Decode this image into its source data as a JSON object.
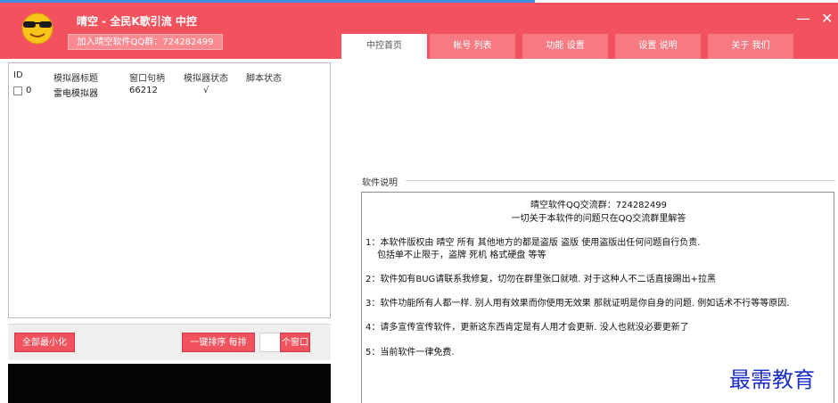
{
  "app": {
    "title": "晴空 - 全民K歌引流 中控",
    "qq_group_label": "加入晴空软件QQ群：724282499",
    "minimize_symbol": "—",
    "close_symbol": "✕"
  },
  "tabs": [
    {
      "label": "中控首页",
      "active": true
    },
    {
      "label": "帐号 列表",
      "active": false
    },
    {
      "label": "功能 设置",
      "active": false
    },
    {
      "label": "设置 说明",
      "active": false
    },
    {
      "label": "关于 我们",
      "active": false
    }
  ],
  "table": {
    "headers": [
      "ID",
      "模拟器标题",
      "窗口句柄",
      "模拟器状态",
      "脚本状态"
    ],
    "rows": [
      {
        "id": "0",
        "title": "雷电模拟器",
        "handle": "66212",
        "emu_status": "√",
        "script_status": ""
      }
    ]
  },
  "buttons": {
    "minimize_all": "全部最小化",
    "one_click_sort": "一键排序 每排",
    "per_window": "个窗口"
  },
  "info": {
    "section_label": "软件说明",
    "lines": [
      "晴空软件QQ交流群：724282499",
      "一切关于本软件的问题只在QQ交流群里解答",
      "1：本软件版权由 晴空 所有 其他地方的都是盗版 盗版 使用盗版出任何问题自行负责.",
      "包括单不止限于，盗牌 死机 格式硬盘 等等",
      "2：软件如有BUG请联系我修复，切勿在群里张口就喷. 对于这种人不二话直接踢出+拉黑",
      "3：软件功能所有人都一样. 别人用有效果而你使用无效果 那就证明是你自身的问题. 例如话术不行等等原因.",
      "4：请多宣传宣传软件，更新这东西肯定是有人用才会更新. 没人也就没必要更新了",
      "5：当前软件一律免费."
    ]
  },
  "watermark": "最需教育",
  "colors": {
    "brand_red": "#f2525d",
    "tab_inactive": "#f77a82",
    "qq_button": "#f88a90",
    "watermark_blue": "#1a2fc8"
  },
  "icons": {
    "logo": "sunglasses-smiley-icon",
    "minimize": "minimize-icon",
    "close": "close-icon"
  }
}
